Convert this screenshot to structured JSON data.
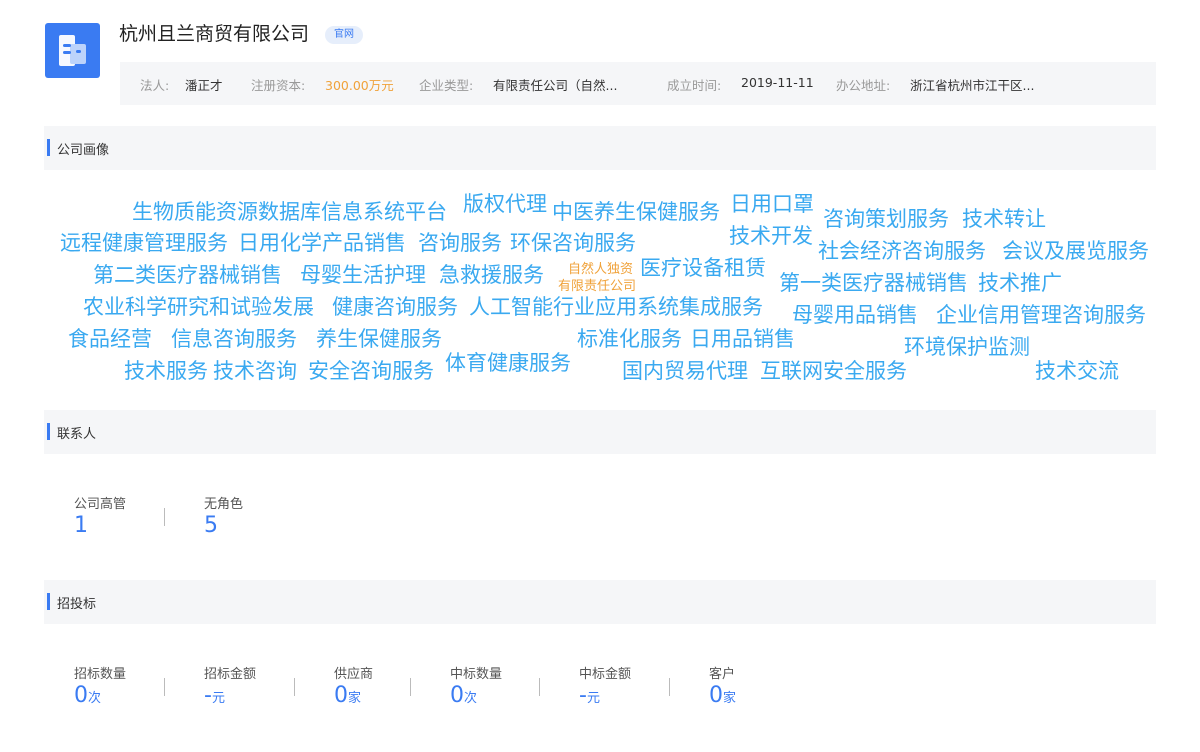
{
  "company": {
    "name": "杭州且兰商贸有限公司",
    "badge": "官网",
    "logo_icon": "building-icon",
    "accent_color": "#3a7bf2"
  },
  "info": {
    "legal_person_label": "法人:",
    "legal_person": "潘正才",
    "capital_label": "注册资本:",
    "capital": "300.00万元",
    "type_label": "企业类型:",
    "type": "有限责任公司（自然...",
    "established_label": "成立时间:",
    "established": "2019-11-11",
    "address_label": "办公地址:",
    "address": "浙江省杭州市江干区..."
  },
  "sections": {
    "portrait": "公司画像",
    "contacts": "联系人",
    "bidding": "招投标"
  },
  "wordcloud": {
    "word_color": "#3aa9f0",
    "tag_color": "#f0a23a",
    "words": [
      "生物质能资源数据库信息系统平台",
      "版权代理",
      "中医养生保健服务",
      "日用口罩",
      "咨询策划服务",
      "技术转让",
      "远程健康管理服务",
      "日用化学产品销售",
      "咨询服务",
      "环保咨询服务",
      "技术开发",
      "社会经济咨询服务",
      "会议及展览服务",
      "第二类医疗器械销售",
      "母婴生活护理",
      "急救援服务",
      "医疗设备租赁",
      "第一类医疗器械销售",
      "技术推广",
      "农业科学研究和试验发展",
      "健康咨询服务",
      "人工智能行业应用系统集成服务",
      "母婴用品销售",
      "企业信用管理咨询服务",
      "食品经营",
      "信息咨询服务",
      "养生保健服务",
      "标准化服务",
      "日用品销售",
      "环境保护监测",
      "技术服务",
      "技术咨询",
      "安全咨询服务",
      "体育健康服务",
      "国内贸易代理",
      "互联网安全服务",
      "技术交流"
    ],
    "tag_line1": "自然人独资",
    "tag_line2": "有限责任公司"
  },
  "contacts": [
    {
      "label": "公司高管",
      "value": "1"
    },
    {
      "label": "无角色",
      "value": "5"
    }
  ],
  "bidding": [
    {
      "label": "招标数量",
      "value": "0",
      "unit": "次"
    },
    {
      "label": "招标金额",
      "value": "-",
      "unit": "元"
    },
    {
      "label": "供应商",
      "value": "0",
      "unit": "家"
    },
    {
      "label": "中标数量",
      "value": "0",
      "unit": "次"
    },
    {
      "label": "中标金额",
      "value": "-",
      "unit": "元"
    },
    {
      "label": "客户",
      "value": "0",
      "unit": "家"
    }
  ]
}
